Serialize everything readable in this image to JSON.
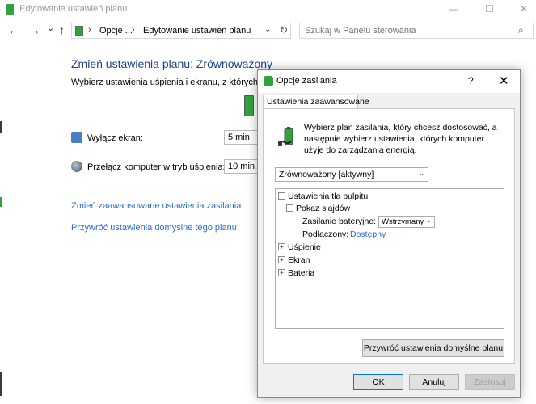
{
  "window": {
    "title": "Edytowanie ustawień planu",
    "minimize": "—",
    "maximize": "☐",
    "close": "✕"
  },
  "nav": {
    "back": "←",
    "forward": "→",
    "recent": "⌄",
    "up": "↑",
    "breadcrumb": [
      "Opcje ...",
      "Edytowanie ustawień planu"
    ],
    "search_placeholder": "Szukaj w Panelu sterowania"
  },
  "main": {
    "heading": "Zmień ustawienia planu: Zrównoważony",
    "subtext": "Wybierz ustawienia uśpienia i ekranu, z których ma k",
    "display_off_label": "Wyłącz ekran:",
    "display_off_value": "5 min",
    "sleep_label": "Przełącz komputer w tryb uśpienia:",
    "sleep_value": "10 min",
    "link_advanced": "Zmień zaawansowane ustawienia zasilania",
    "link_restore": "Przywróć ustawienia domyślne tego planu"
  },
  "dialog": {
    "title": "Opcje zasilania",
    "help": "?",
    "close": "✕",
    "tab": "Ustawienia zaawansowane",
    "intro": "Wybierz plan zasilania, który chcesz dostosować, a następnie wybierz ustawienia, których komputer użyje do zarządzania energią.",
    "plan": "Zrównoważony [aktywny]",
    "tree": {
      "desktop_bg": "Ustawienia tła pulpitu",
      "slideshow": "Pokaz slajdów",
      "battery_label": "Zasilanie bateryjne:",
      "battery_value": "Wstrzymany",
      "plugged_label": "Podłączony:",
      "plugged_value": "Dostępny",
      "sleep": "Uśpienie",
      "display": "Ekran",
      "battery": "Bateria"
    },
    "restore_button": "Przywróć ustawienia domyślne planu",
    "ok": "OK",
    "cancel": "Anuluj",
    "apply": "Zastosuj"
  }
}
